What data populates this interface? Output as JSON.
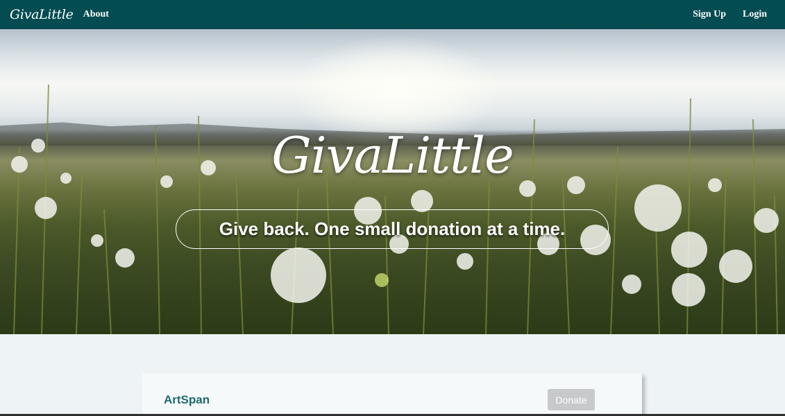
{
  "navbar": {
    "brand": "GivaLittle",
    "about": "About",
    "sign_up": "Sign Up",
    "login": "Login",
    "background": "#034c52"
  },
  "hero": {
    "title": "GivaLittle",
    "tagline": "Give back. One small donation at a time.",
    "image": "dandelion-field-photo"
  },
  "charities": [
    {
      "name": "ArtSpan",
      "donate_label": "Donate"
    }
  ],
  "colors": {
    "accent": "#1e6a70",
    "page_bg": "#eef4f6",
    "donate_disabled": "#c7c9ca"
  }
}
